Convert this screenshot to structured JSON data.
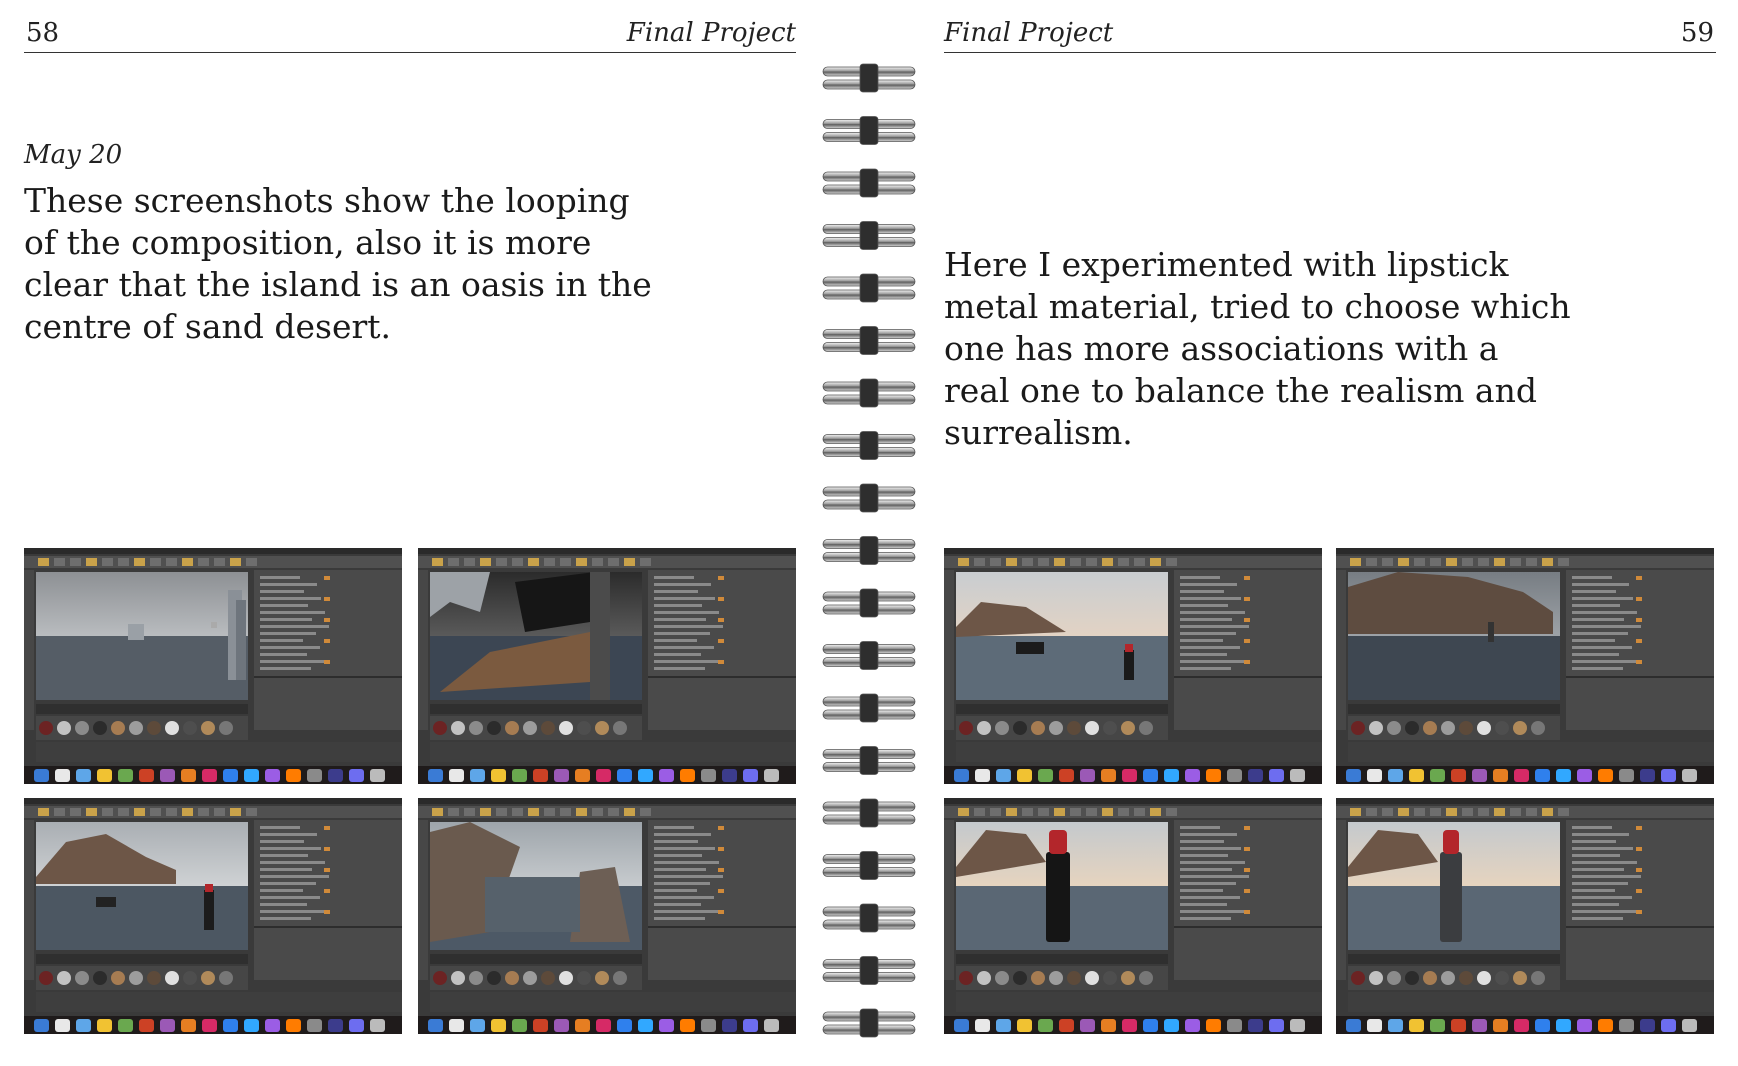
{
  "left_page": {
    "page_number": "58",
    "running_title": "Final Project",
    "date": "May 20",
    "body_lines": [
      "These screenshots show the looping",
      "of the composition, also it is more",
      "clear that the island is an oasis in the",
      "centre of sand desert."
    ],
    "screenshots": [
      {
        "scene": "grey-water-cylinder"
      },
      {
        "scene": "box-interior-water"
      },
      {
        "scene": "rock-island-lipstick"
      },
      {
        "scene": "rock-reflection-pool"
      }
    ]
  },
  "right_page": {
    "page_number": "59",
    "running_title": "Final Project",
    "body_lines": [
      "Here I experimented with lipstick",
      "metal material, tried to choose which",
      "one has more associations with a",
      "real one to balance the realism and",
      "surrealism."
    ],
    "screenshots": [
      {
        "scene": "rock-sunset-lipstick-small"
      },
      {
        "scene": "dark-rock-lake"
      },
      {
        "scene": "lipstick-close-sunset"
      },
      {
        "scene": "lipstick-close-sunset-2"
      }
    ]
  },
  "colors": {
    "rule": "#333333",
    "ui_dark": "#3a3a3a",
    "ui_panel": "#4a4a4a",
    "water": "#5b6a78",
    "lipstick_red": "#b3262b",
    "rock": "#6d5647"
  },
  "binding": {
    "type": "spiral-wire",
    "ring_count": 19
  }
}
